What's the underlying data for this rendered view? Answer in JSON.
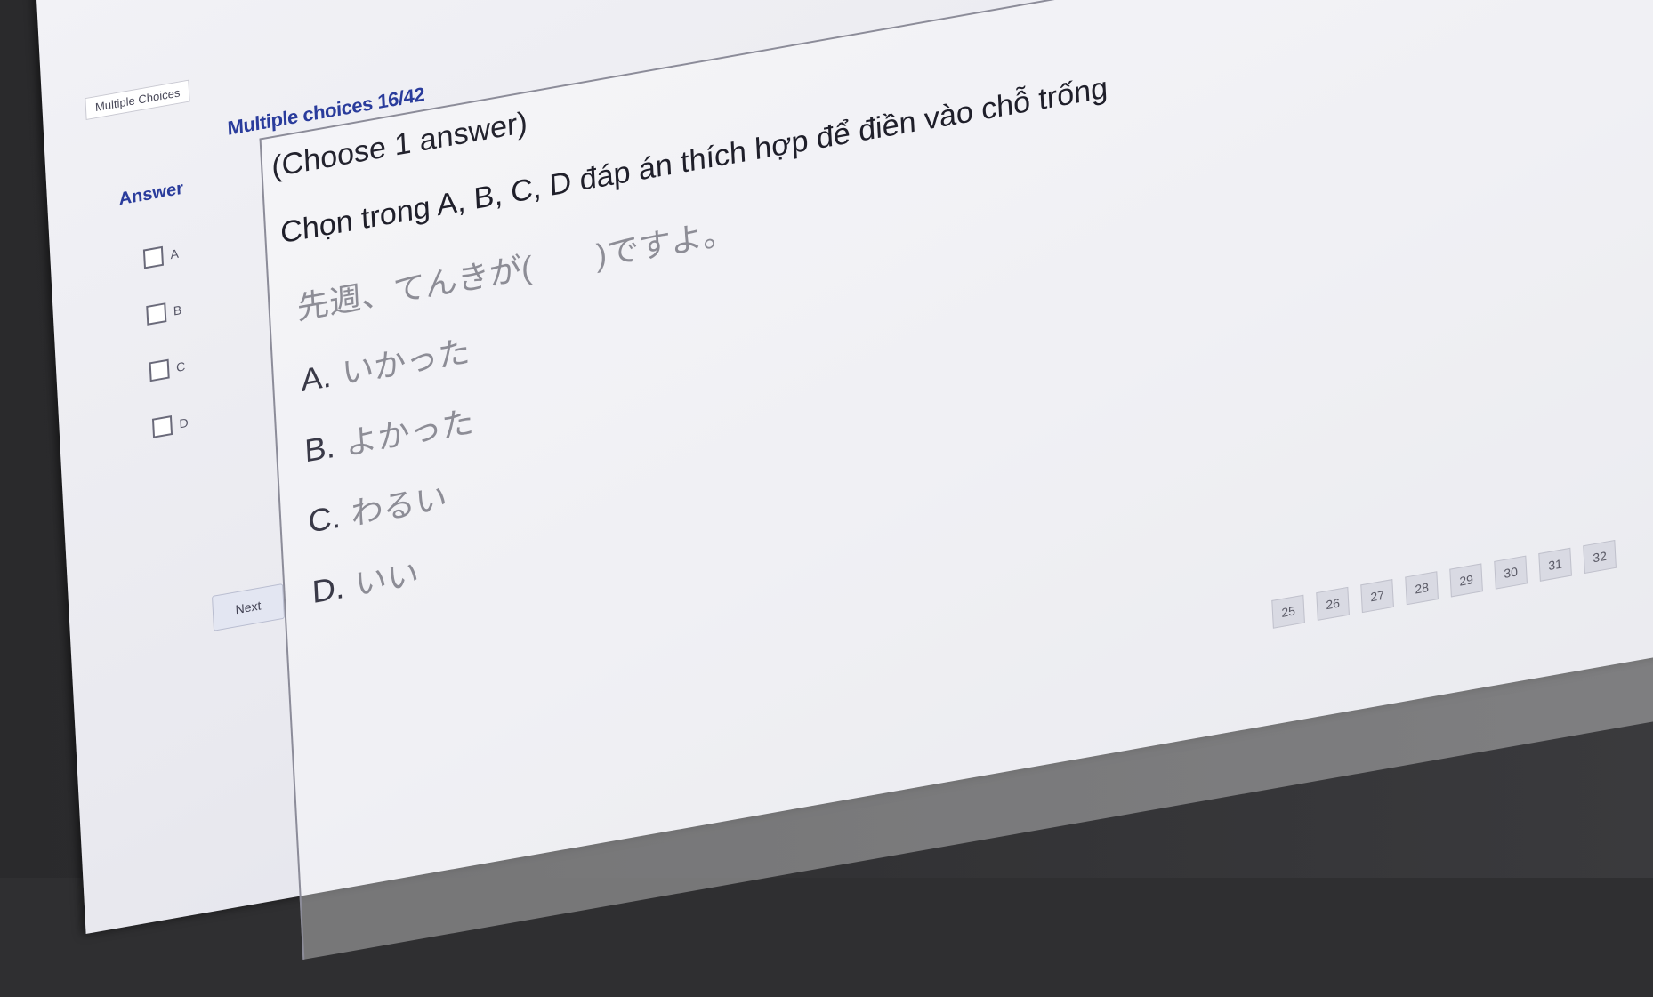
{
  "window": {
    "tab_label": "Multiple Choices"
  },
  "header": {
    "section_title": "Multiple choices 16/42"
  },
  "answer_panel": {
    "label": "Answer",
    "options": [
      {
        "key": "A"
      },
      {
        "key": "B"
      },
      {
        "key": "C"
      },
      {
        "key": "D"
      }
    ],
    "next_label": "Next"
  },
  "question": {
    "instruction": "(Choose 1 answer)",
    "prompt": "Chọn trong A, B, C, D đáp án thích hợp để điền vào chỗ trống",
    "sentence": "先週、てんきが(　　)ですよ。",
    "options": [
      {
        "letter": "A.",
        "text": "いかった"
      },
      {
        "letter": "B.",
        "text": "よかった"
      },
      {
        "letter": "C.",
        "text": "わるい"
      },
      {
        "letter": "D.",
        "text": "いい"
      }
    ]
  },
  "pager": {
    "pages": [
      "25",
      "26",
      "27",
      "28",
      "29",
      "30",
      "31",
      "32"
    ]
  }
}
